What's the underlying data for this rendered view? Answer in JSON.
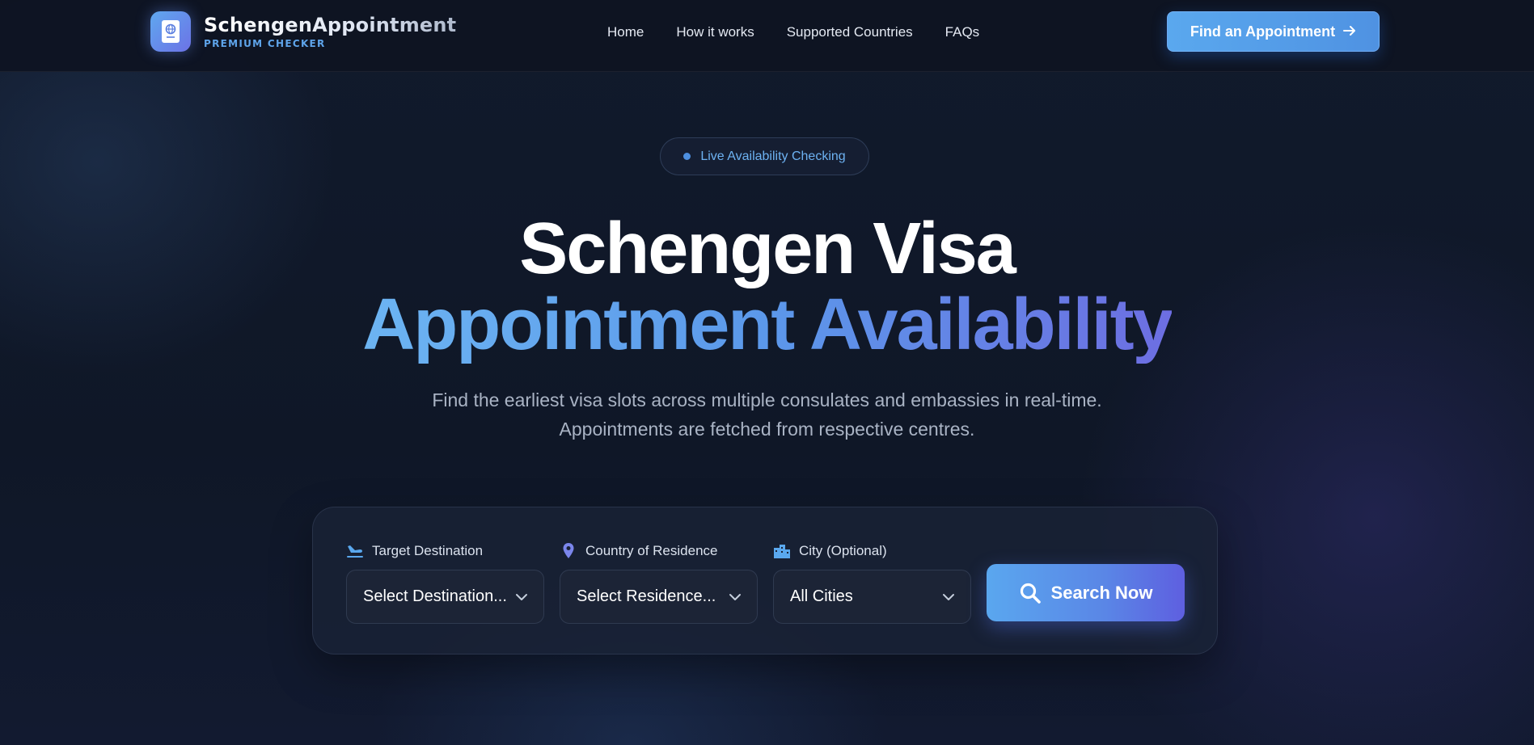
{
  "brand": {
    "name": "SchengenAppointment",
    "subtitle": "PREMIUM CHECKER",
    "logo_icon": "passport-icon"
  },
  "nav": {
    "links": [
      "Home",
      "How it works",
      "Supported Countries",
      "FAQs"
    ],
    "cta_label": "Find an Appointment",
    "cta_icon": "arrow-right-icon"
  },
  "badge": {
    "text": "Live Availability Checking"
  },
  "hero": {
    "title_line1": "Schengen Visa",
    "title_line2": "Appointment Availability",
    "subtitle": "Find the earliest visa slots across multiple consulates and embassies in real-time. Appointments are fetched from respective centres."
  },
  "search": {
    "destination": {
      "label": "Target Destination",
      "icon": "airplane-landing-icon",
      "value": "Select Destination..."
    },
    "residence": {
      "label": "Country of Residence",
      "icon": "map-pin-icon",
      "value": "Select Residence..."
    },
    "city": {
      "label": "City (Optional)",
      "icon": "city-buildings-icon",
      "value": "All Cities"
    },
    "button_label": "Search Now",
    "button_icon": "search-icon"
  },
  "colors": {
    "accent_blue": "#5aa8ee",
    "accent_indigo": "#6d6ee2",
    "background": "#0f1626"
  }
}
